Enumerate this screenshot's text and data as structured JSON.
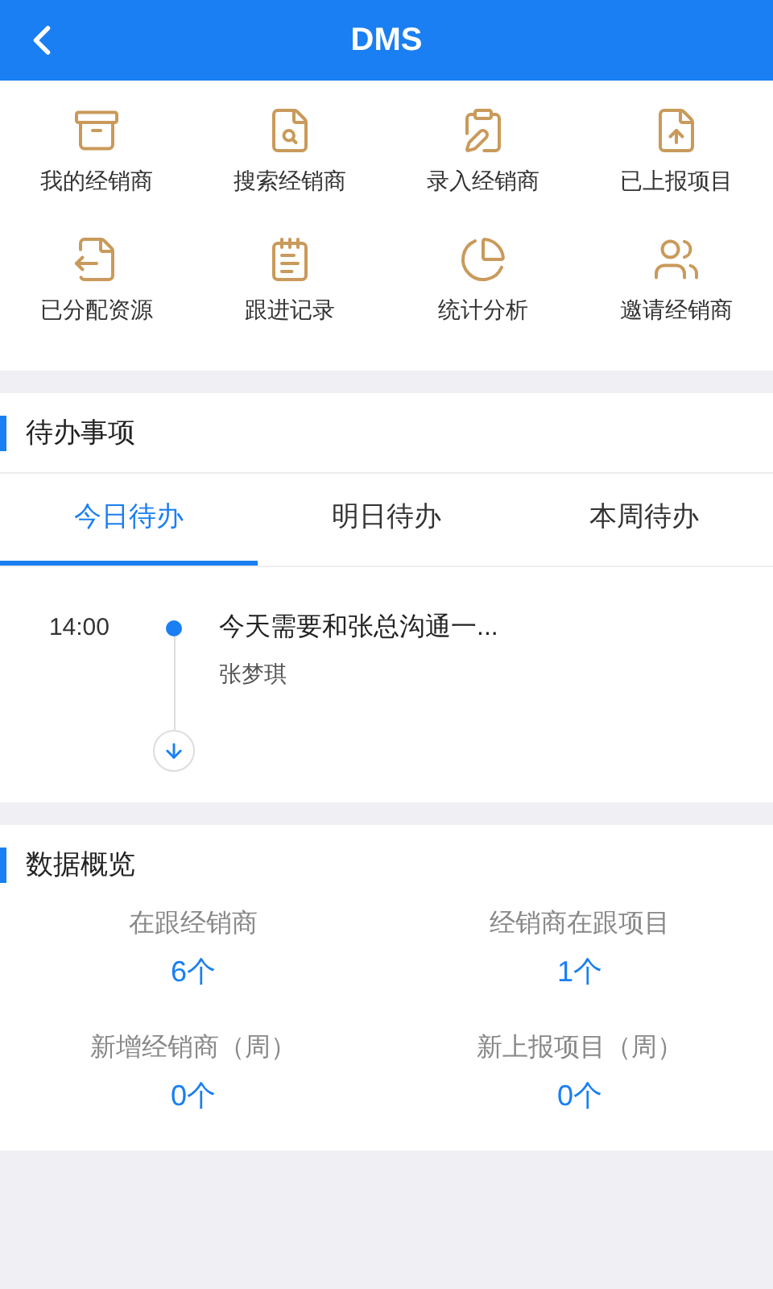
{
  "header": {
    "title": "DMS"
  },
  "shortcuts": [
    {
      "label": "我的经销商"
    },
    {
      "label": "搜索经销商"
    },
    {
      "label": "录入经销商"
    },
    {
      "label": "已上报项目"
    },
    {
      "label": "已分配资源"
    },
    {
      "label": "跟进记录"
    },
    {
      "label": "统计分析"
    },
    {
      "label": "邀请经销商"
    }
  ],
  "todo": {
    "title": "待办事项",
    "tabs": [
      {
        "label": "今日待办",
        "selected": true
      },
      {
        "label": "明日待办",
        "selected": false
      },
      {
        "label": "本周待办",
        "selected": false
      }
    ],
    "items": [
      {
        "time": "14:00",
        "text": "今天需要和张总沟通一...",
        "person": "张梦琪"
      }
    ]
  },
  "overview": {
    "title": "数据概览",
    "stats": [
      {
        "label": "在跟经销商",
        "value": "6个"
      },
      {
        "label": "经销商在跟项目",
        "value": "1个"
      },
      {
        "label": "新增经销商（周）",
        "value": "0个"
      },
      {
        "label": "新上报项目（周）",
        "value": "0个"
      }
    ]
  }
}
